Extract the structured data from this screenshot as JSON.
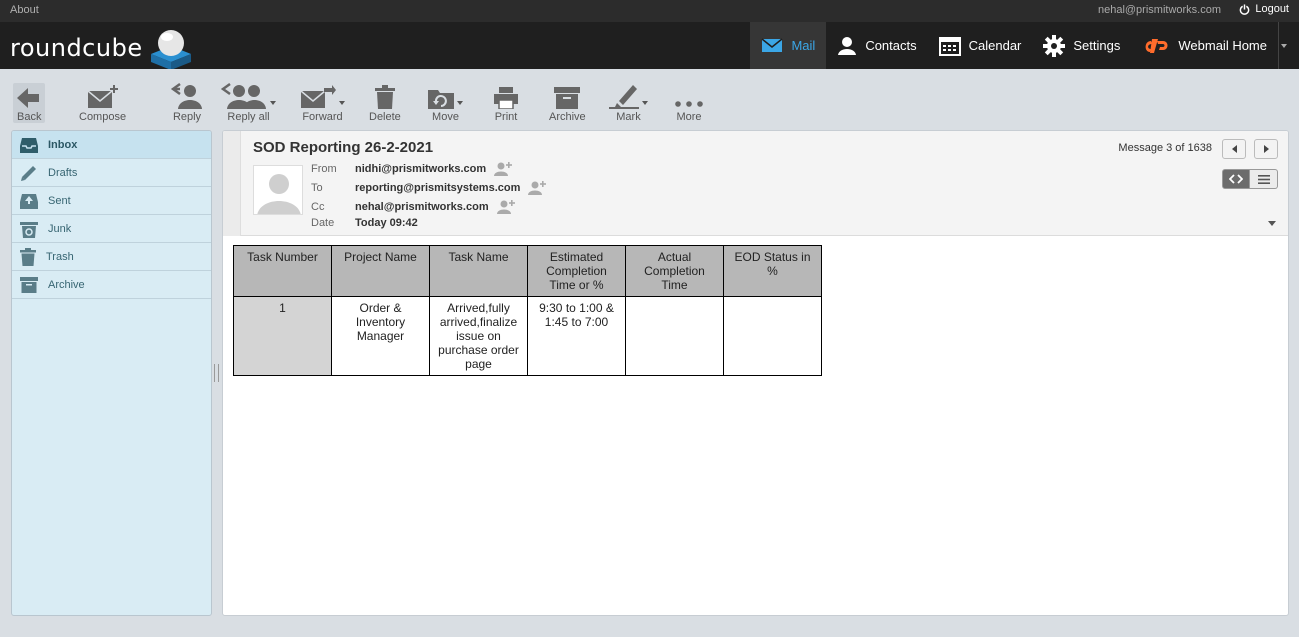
{
  "topbar": {
    "about": "About",
    "user_email": "nehal@prismitworks.com",
    "logout": "Logout"
  },
  "header": {
    "logo_text": "roundcube",
    "nav": [
      {
        "label": "Mail",
        "icon": "mail-icon",
        "active": true
      },
      {
        "label": "Contacts",
        "icon": "contacts-icon"
      },
      {
        "label": "Calendar",
        "icon": "calendar-icon"
      },
      {
        "label": "Settings",
        "icon": "gear-icon"
      },
      {
        "label": "Webmail Home",
        "icon": "cpanel-icon"
      }
    ]
  },
  "toolbar": {
    "back": "Back",
    "compose": "Compose",
    "reply": "Reply",
    "reply_all": "Reply all",
    "forward": "Forward",
    "delete": "Delete",
    "move": "Move",
    "print": "Print",
    "archive": "Archive",
    "mark": "Mark",
    "more": "More"
  },
  "folders": [
    {
      "label": "Inbox",
      "icon": "inbox-icon",
      "active": true
    },
    {
      "label": "Drafts",
      "icon": "pencil-icon"
    },
    {
      "label": "Sent",
      "icon": "sent-icon"
    },
    {
      "label": "Junk",
      "icon": "junk-icon"
    },
    {
      "label": "Trash",
      "icon": "trash-icon"
    },
    {
      "label": "Archive",
      "icon": "archive-icon"
    }
  ],
  "message": {
    "subject": "SOD Reporting 26-2-2021",
    "counter": "Message 3 of 1638",
    "headers": {
      "from_label": "From",
      "from": "nidhi@prismitworks.com",
      "to_label": "To",
      "to": "reporting@prismitsystems.com",
      "cc_label": "Cc",
      "cc": "nehal@prismitworks.com",
      "date_label": "Date",
      "date": "Today 09:42"
    },
    "table": {
      "headers": [
        "Task Number",
        "Project Name",
        "Task Name",
        "Estimated Completion Time or %",
        "Actual Completion Time",
        "EOD Status in %"
      ],
      "rows": [
        [
          "1",
          "Order & Inventory Manager",
          "Arrived,fully arrived,finalize issue on purchase order page",
          "9:30 to 1:00 & 1:45 to 7:00",
          "",
          ""
        ]
      ]
    }
  }
}
